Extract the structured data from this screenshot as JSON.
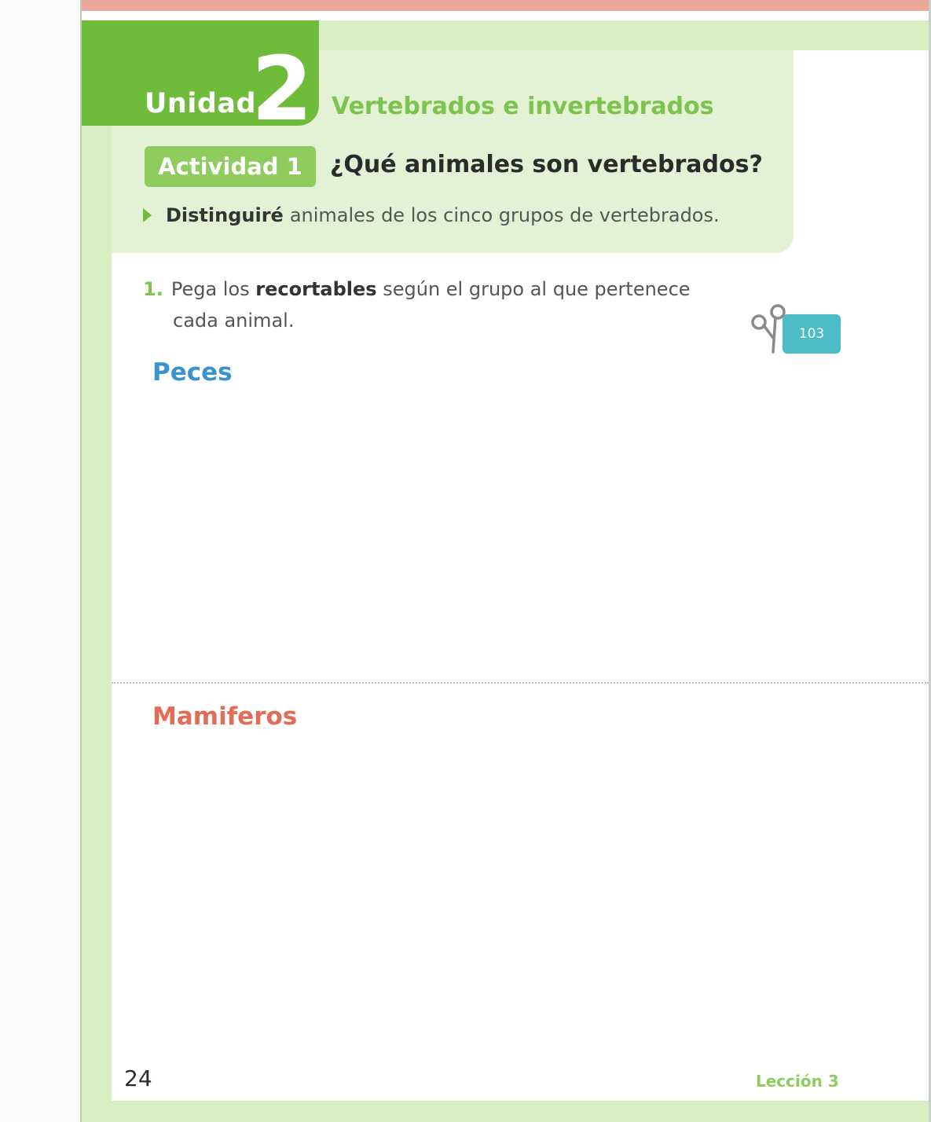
{
  "header": {
    "unit_label": "Unidad",
    "unit_number": "2",
    "unit_title": "Vertebrados e invertebrados"
  },
  "activity": {
    "label": "Actividad 1",
    "title": "¿Qué animales son vertebrados?",
    "objective_verb": "Distinguiré",
    "objective_rest": "animales de los cinco grupos de vertebrados."
  },
  "instruction": {
    "number": "1.",
    "text_before": "Pega los",
    "text_bold": "recortables",
    "text_after": "según el grupo al que pertenece",
    "line2": "cada animal."
  },
  "cutout_badge": {
    "icon": "scissors-icon",
    "page_ref": "103"
  },
  "sections": {
    "peces": "Peces",
    "mamiferos": "Mamiferos"
  },
  "footer": {
    "page_number": "24",
    "lesson": "Lección 3"
  },
  "colors": {
    "unit_green": "#6fbc3a",
    "light_green": "#d8efc4",
    "peces_blue": "#3a93cf",
    "mamiferos_red": "#e46b55",
    "cut_badge_teal": "#4cbcc7",
    "top_strip": "#e8a99b"
  }
}
